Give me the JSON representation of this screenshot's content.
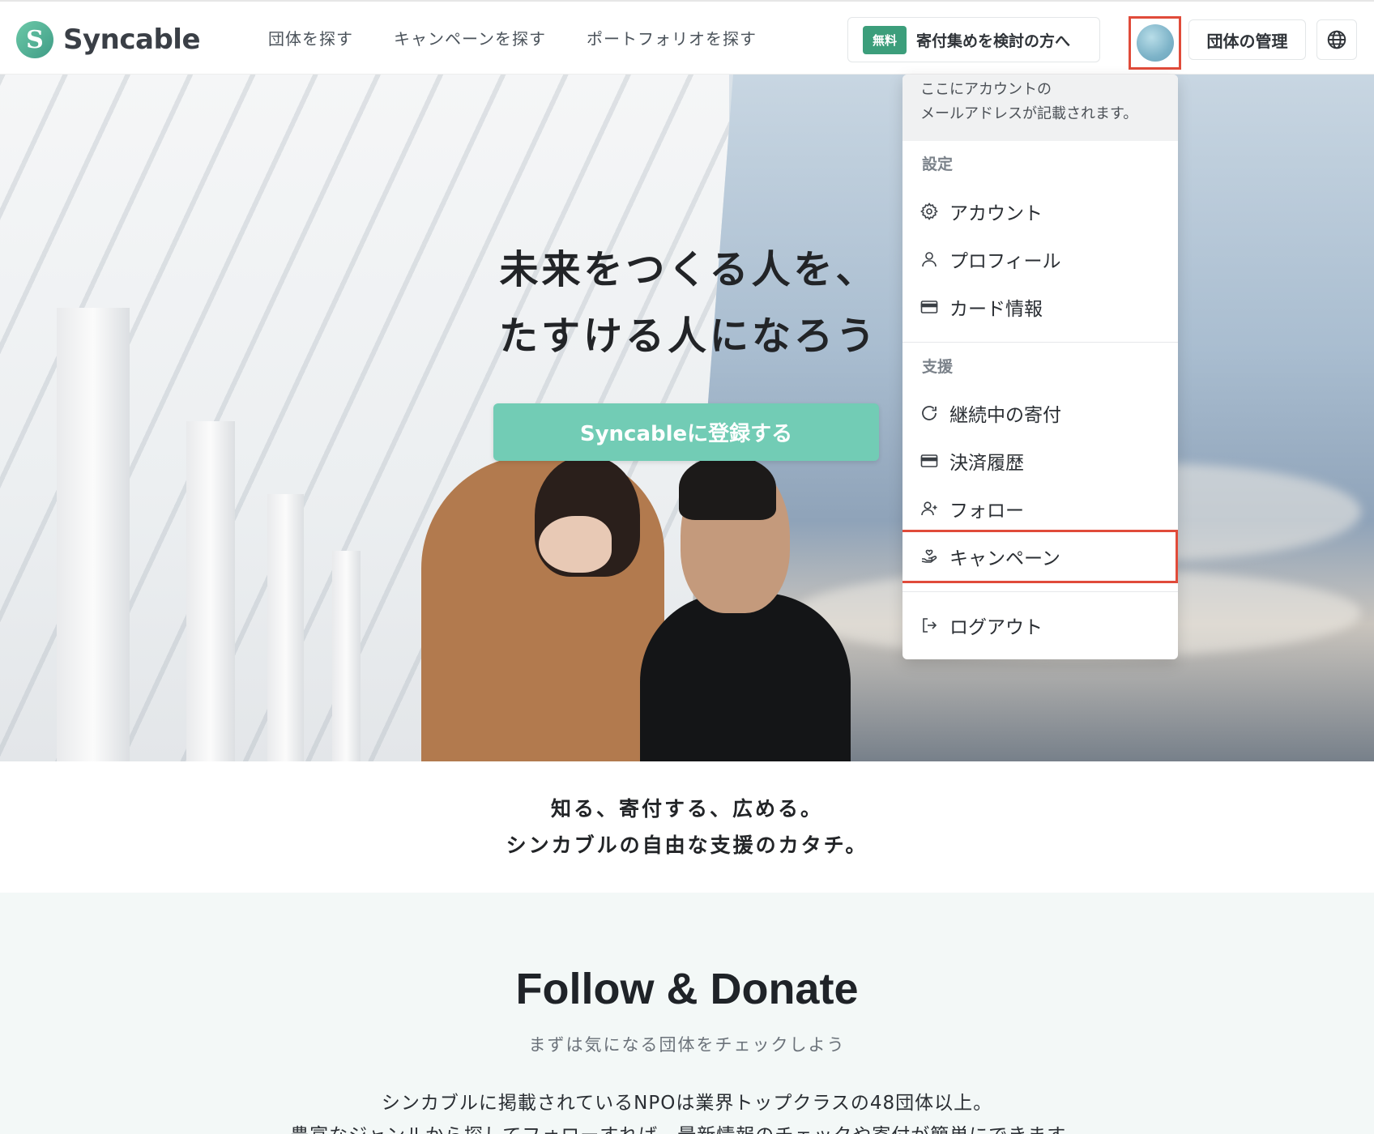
{
  "header": {
    "logo_text": "Syncable",
    "nav": [
      "団体を探す",
      "キャンペーンを探す",
      "ポートフォリオを探す"
    ],
    "free_badge": "無料",
    "free_cta": "寄付集めを検討の方へ",
    "org_button": "団体の管理"
  },
  "hero": {
    "title_line1": "未来をつくる人を、",
    "title_line2": "たすける人になろう",
    "cta": "Syncableに登録する"
  },
  "dropdown": {
    "email_line1": "ここにアカウントの",
    "email_line2": "メールアドレスが記載されます。",
    "settings_label": "設定",
    "settings_items": [
      {
        "label": "アカウント",
        "icon": "gear-icon"
      },
      {
        "label": "プロフィール",
        "icon": "user-icon"
      },
      {
        "label": "カード情報",
        "icon": "credit-card-icon"
      }
    ],
    "support_label": "支援",
    "support_items": [
      {
        "label": "継続中の寄付",
        "icon": "refresh-icon"
      },
      {
        "label": "決済履歴",
        "icon": "credit-card-icon"
      },
      {
        "label": "フォロー",
        "icon": "user-plus-icon"
      },
      {
        "label": "キャンペーン",
        "icon": "hand-heart-icon"
      }
    ],
    "logout": "ログアウト"
  },
  "tagline": {
    "line1": "知る、寄付する、広める。",
    "line2": "シンカブルの自由な支援のカタチ。"
  },
  "follow": {
    "title": "Follow & Donate",
    "subtitle": "まずは気になる団体をチェックしよう",
    "desc_line1": "シンカブルに掲載されているNPOは業界トップクラスの48団体以上。",
    "desc_line2": "豊富なジャンルから探してフォローすれば、最新情報のチェックや寄付が簡単にできます。"
  },
  "colors": {
    "brand_green": "#3c9e7b",
    "cta_green": "#72ccb5",
    "highlight_red": "#e04b3a"
  }
}
